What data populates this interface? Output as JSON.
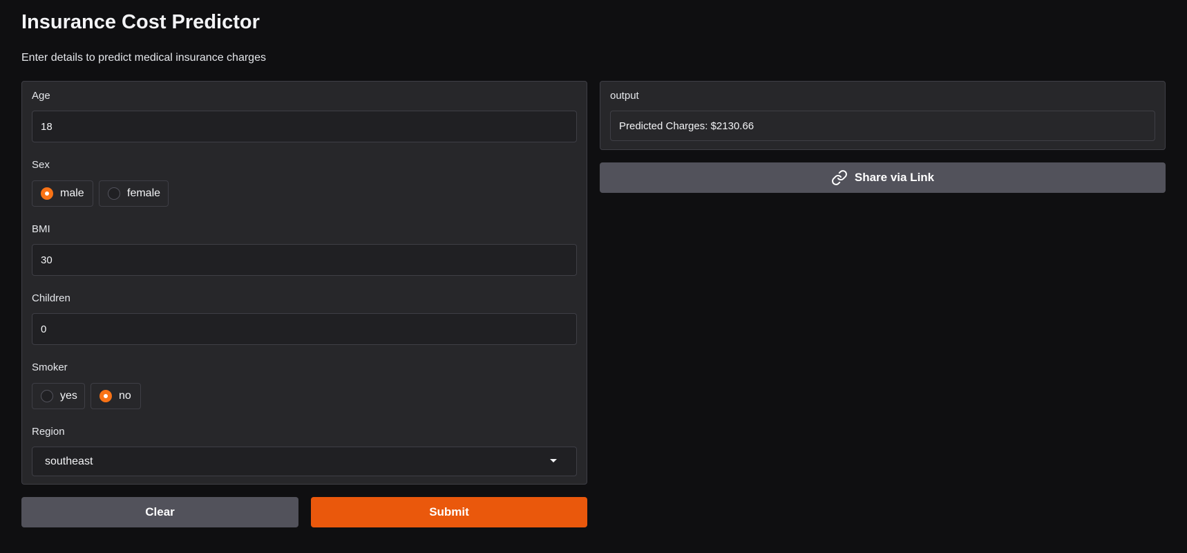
{
  "header": {
    "title": "Insurance Cost Predictor",
    "description": "Enter details to predict medical insurance charges"
  },
  "form": {
    "age": {
      "label": "Age",
      "value": "18"
    },
    "sex": {
      "label": "Sex",
      "options": [
        {
          "label": "male",
          "checked": true
        },
        {
          "label": "female",
          "checked": false
        }
      ]
    },
    "bmi": {
      "label": "BMI",
      "value": "30"
    },
    "children": {
      "label": "Children",
      "value": "0"
    },
    "smoker": {
      "label": "Smoker",
      "options": [
        {
          "label": "yes",
          "checked": false
        },
        {
          "label": "no",
          "checked": true
        }
      ]
    },
    "region": {
      "label": "Region",
      "value": "southeast"
    }
  },
  "actions": {
    "clear_label": "Clear",
    "submit_label": "Submit"
  },
  "output": {
    "label": "output",
    "value": "Predicted Charges: $2130.66",
    "share_label": "Share via Link"
  },
  "colors": {
    "background": "#0f0f11",
    "panel": "#27272a",
    "accent": "#ea580c",
    "secondary_button": "#52525b"
  },
  "icons": {
    "share": "link-icon",
    "dropdown": "chevron-down-icon"
  }
}
